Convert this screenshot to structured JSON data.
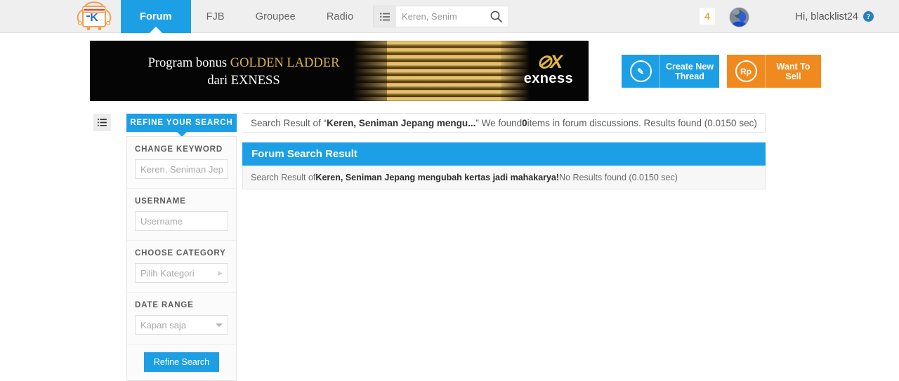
{
  "header": {
    "logo_alt": "kaskus-mascot-logo",
    "nav": [
      {
        "label": "Forum",
        "active": true
      },
      {
        "label": "FJB",
        "active": false
      },
      {
        "label": "Groupee",
        "active": false
      },
      {
        "label": "Radio",
        "active": false
      }
    ],
    "search": {
      "category_icon": "list-icon",
      "value": "Keren, Senim",
      "placeholder": "Keren, Senim",
      "submit_icon": "search-icon"
    },
    "notification_count": "4",
    "greeting": "Hi, blacklist24",
    "help_icon_label": "?"
  },
  "banner": {
    "line1_prefix": "Program bonus ",
    "line1_highlight": "GOLDEN LADDER",
    "line2": "dari EXNESS",
    "brand_mark": "⊘X",
    "brand_word": "exness"
  },
  "actions": {
    "create_thread": {
      "icon": "pencil-icon",
      "glyph": "✎",
      "label": "Create New Thread"
    },
    "want_to_sell": {
      "icon": "rupiah-icon",
      "glyph": "Rp",
      "label": "Want To Sell"
    }
  },
  "toolbar": {
    "list_toggle_icon": "list-icon",
    "refine_tab_label": "REFINE YOUR SEARCH",
    "summary": {
      "prefix": "Search Result of “",
      "query": "Keren, Seniman Jepang mengu...",
      "middle": "” We found ",
      "count": "0",
      "suffix": " items in forum discussions. Results found (0.0150 sec)"
    }
  },
  "sidebar": {
    "filters": [
      {
        "label": "CHANGE KEYWORD",
        "type": "input",
        "value": "",
        "placeholder": "Keren, Seniman Jepa"
      },
      {
        "label": "USERNAME",
        "type": "input",
        "value": "",
        "placeholder": "Username"
      },
      {
        "label": "CHOOSE CATEGORY",
        "type": "select-right",
        "value": "Pilih Kategori"
      },
      {
        "label": "DATE RANGE",
        "type": "select-down",
        "value": "Kapan saja"
      }
    ],
    "refine_button_label": "Refine Search"
  },
  "result": {
    "title": "Forum Search Result",
    "body_prefix": "Search Result of ",
    "body_query": "Keren, Seniman Jepang mengubah kertas jadi mahakarya!",
    "body_suffix": " No Results found (0.0150 sec)"
  },
  "colors": {
    "accent_blue": "#1d9fe5",
    "accent_orange": "#f08a1e",
    "header_bg": "#efefef",
    "badge_orange": "#e8a33d"
  }
}
